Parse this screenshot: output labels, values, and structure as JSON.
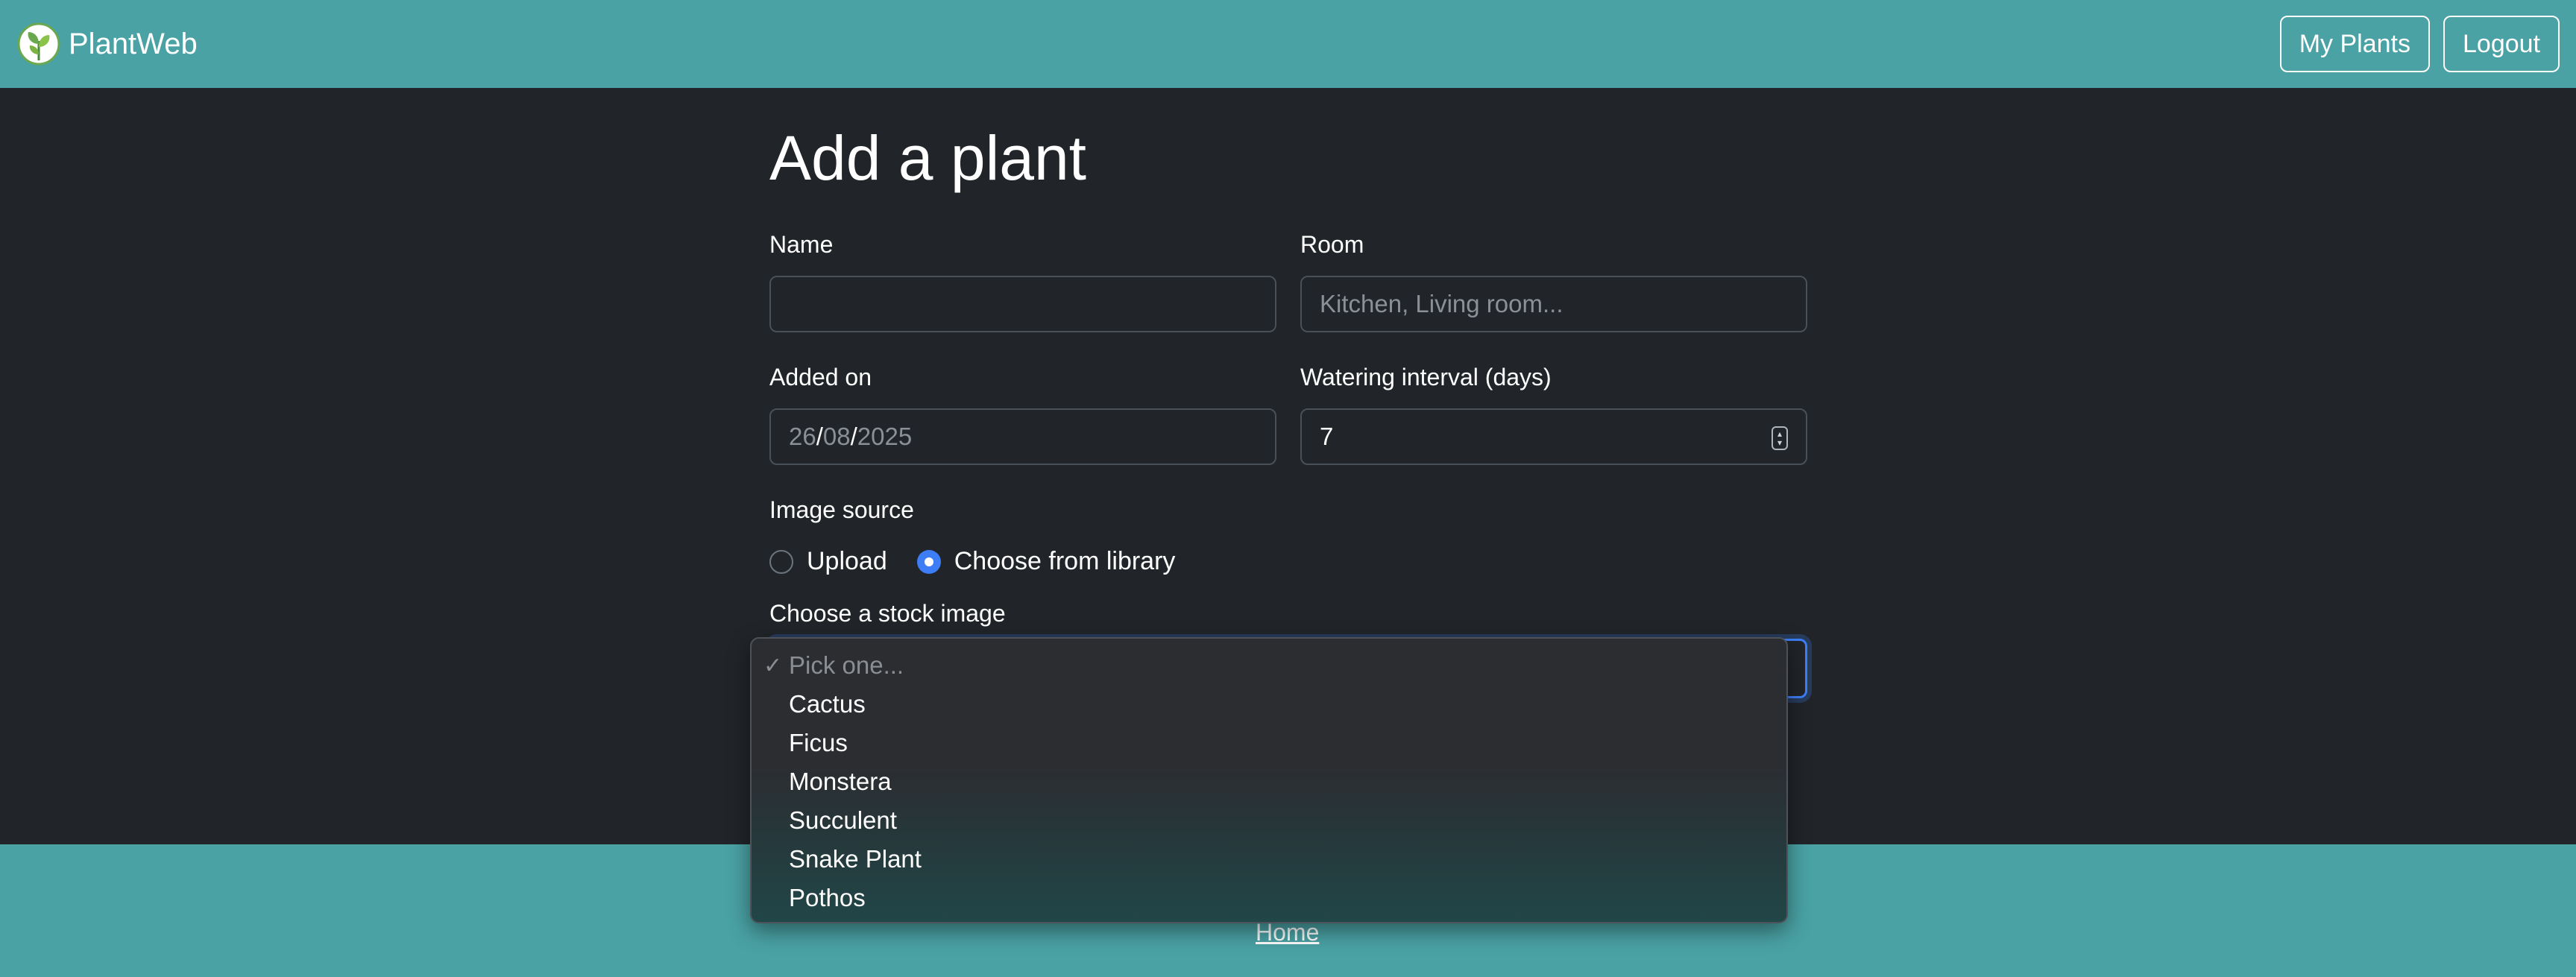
{
  "app": {
    "name": "PlantWeb"
  },
  "nav": {
    "my_plants": "My Plants",
    "logout": "Logout"
  },
  "page": {
    "title": "Add a plant"
  },
  "form": {
    "name": {
      "label": "Name",
      "value": "",
      "placeholder": ""
    },
    "room": {
      "label": "Room",
      "placeholder": "Kitchen, Living room..."
    },
    "added_on": {
      "label": "Added on",
      "day": "26",
      "month": "08",
      "year": "2025",
      "separator": "/"
    },
    "watering": {
      "label": "Watering interval (days)",
      "value": "7"
    },
    "image_source": {
      "label": "Image source",
      "options": [
        {
          "label": "Upload",
          "checked": false
        },
        {
          "label": "Choose from library",
          "checked": true
        }
      ]
    },
    "stock_image": {
      "label": "Choose a stock image",
      "check_mark": "✓",
      "options": [
        "Pick one...",
        "Cactus",
        "Ficus",
        "Monstera",
        "Succulent",
        "Snake Plant",
        "Pothos"
      ],
      "selected_index": 0
    }
  },
  "footer": {
    "home_link": "Home"
  },
  "colors": {
    "navbar": "#4aa2a5",
    "background": "#212529",
    "accent": "#3d7ef6"
  }
}
